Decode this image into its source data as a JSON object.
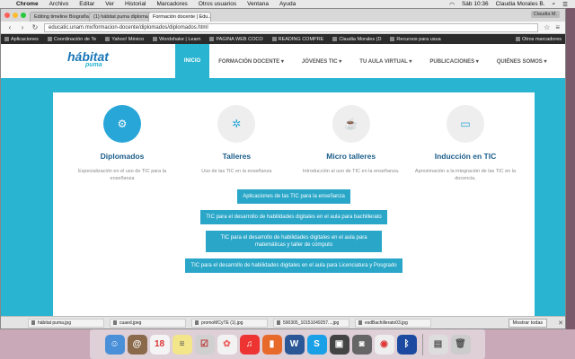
{
  "menubar": {
    "app": "Chrome",
    "items": [
      "Archivo",
      "Editar",
      "Ver",
      "Historial",
      "Marcadores",
      "Otros usuarios",
      "Ventana",
      "Ayuda"
    ],
    "clock": "Sáb 10:36",
    "user": "Claudia Morales B."
  },
  "browser": {
    "tabs": [
      {
        "label": "Editing timeline Biografía"
      },
      {
        "label": "(1) hábitat puma diplomas"
      },
      {
        "label": "Formación docente | Edu..."
      }
    ],
    "profile": "Claudia M.",
    "url": "educatic.unam.mx/formacion-docente/diplomados/diplomados.html",
    "bookmarks": [
      "Aplicaciones",
      "Coordinación de Te",
      "Yahoo! México",
      "Wordshake | Learn",
      "PAGINA WEB COCO",
      "READING COMPRE",
      "Claudia Morales (D",
      "Recursos para usua"
    ],
    "other_bookmarks": "Otros marcadores"
  },
  "site": {
    "logo_main": "hábitat",
    "logo_sub": "puma",
    "nav": [
      "INICIO",
      "FORMACIÓN DOCENTE ▾",
      "JÓVENES TIC ▾",
      "TU AULA VIRTUAL ▾",
      "PUBLICACIONES ▾",
      "QUIÉNES SOMOS ▾"
    ],
    "features": [
      {
        "icon": "gears-icon",
        "glyph": "⚙",
        "title": "Diplomados",
        "desc": "Especialización en el uso de TIC para la enseñanza"
      },
      {
        "icon": "gear-icon",
        "glyph": "✲",
        "title": "Talleres",
        "desc": "Uso de las TIC en la enseñanza"
      },
      {
        "icon": "coffee-icon",
        "glyph": "☕",
        "title": "Micro talleres",
        "desc": "Introducción al uso de TIC en la enseñanza."
      },
      {
        "icon": "laptop-icon",
        "glyph": "▭",
        "title": "Inducción en TIC",
        "desc": "Aproximación a la integración de las TIC en la docencia."
      }
    ],
    "buttons": [
      "Aplicaciones de las TIC para la enseñanza",
      "TIC para el desarrollo de habilidades digitales en el aula para bachillerato",
      "TIC para el desarrollo de habilidades digitales en el aula para matemáticas y taller de cómputo",
      "TIC para el desarrollo de habilidades digitales en el aula para Licenciatura y Posgrado"
    ]
  },
  "downloads": {
    "files": [
      "hábitat puma.jpg",
      "cuaed.jpeg",
      "promoMCyTE (1).jpg",
      "590305_10151049257....jpg",
      "esdBachillerato03.jpg"
    ],
    "show_all": "Mostrar todas"
  },
  "colors": {
    "accent": "#29b4d2",
    "title": "#1a5d8a",
    "button": "#29a6c8"
  }
}
